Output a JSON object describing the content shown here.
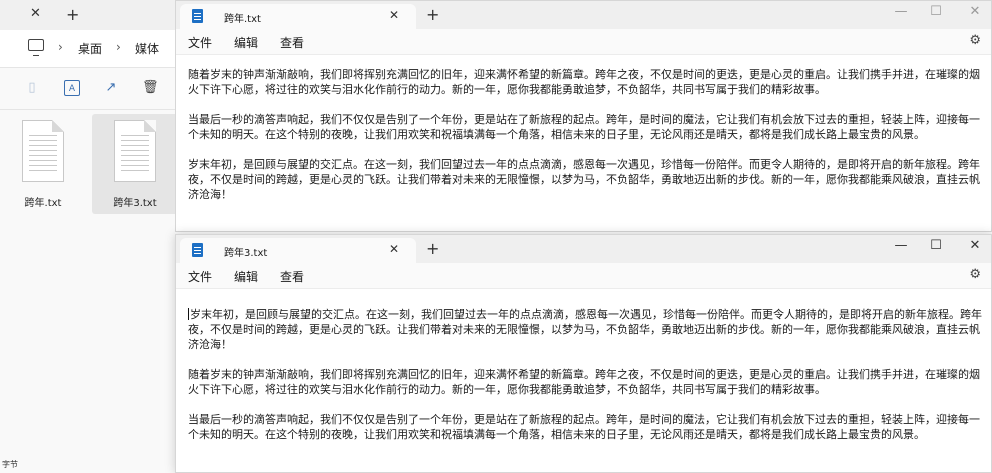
{
  "explorer": {
    "tab_close": "✕",
    "tab_add": "+",
    "breadcrumb": [
      "桌面",
      "媒体"
    ],
    "files": [
      {
        "name": "跨年.txt",
        "selected": false
      },
      {
        "name": "跨年3.txt",
        "selected": true
      }
    ],
    "status_text": "字节"
  },
  "notepad_back": {
    "tab_title": "跨年.txt",
    "menu": [
      "文件",
      "编辑",
      "查看"
    ],
    "paragraphs": [
      "随着岁末的钟声渐渐敲响，我们即将挥别充满回忆的旧年，迎来满怀希望的新篇章。跨年之夜，不仅是时间的更迭，更是心灵的重启。让我们携手并进，在璀璨的烟火下许下心愿，将过往的欢笑与泪水化作前行的动力。新的一年，愿你我都能勇敢追梦，不负韶华，共同书写属于我们的精彩故事。",
      "当最后一秒的滴答声响起，我们不仅仅是告别了一个年份，更是站在了新旅程的起点。跨年，是时间的魔法，它让我们有机会放下过去的重担，轻装上阵，迎接每一个未知的明天。在这个特别的夜晚，让我们用欢笑和祝福填满每一个角落，相信未来的日子里，无论风雨还是晴天，都将是我们成长路上最宝贵的风景。",
      "岁末年初，是回顾与展望的交汇点。在这一刻，我们回望过去一年的点点滴滴，感恩每一次遇见，珍惜每一份陪伴。而更令人期待的，是即将开启的新年旅程。跨年夜，不仅是时间的跨越，更是心灵的飞跃。让我们带着对未来的无限憧憬，以梦为马，不负韶华，勇敢地迈出新的步伐。新的一年，愿你我都能乘风破浪，直挂云帆济沧海！"
    ]
  },
  "notepad_front": {
    "tab_title": "跨年3.txt",
    "menu": [
      "文件",
      "编辑",
      "查看"
    ],
    "paragraphs": [
      "岁末年初，是回顾与展望的交汇点。在这一刻，我们回望过去一年的点点滴滴，感恩每一次遇见，珍惜每一份陪伴。而更令人期待的，是即将开启的新年旅程。跨年夜，不仅是时间的跨越，更是心灵的飞跃。让我们带着对未来的无限憧憬，以梦为马，不负韶华，勇敢地迈出新的步伐。新的一年，愿你我都能乘风破浪，直挂云帆济沧海！",
      "随着岁末的钟声渐渐敲响，我们即将挥别充满回忆的旧年，迎来满怀希望的新篇章。跨年之夜，不仅是时间的更迭，更是心灵的重启。让我们携手并进，在璀璨的烟火下许下心愿，将过往的欢笑与泪水化作前行的动力。新的一年，愿你我都能勇敢追梦，不负韶华，共同书写属于我们的精彩故事。",
      "当最后一秒的滴答声响起，我们不仅仅是告别了一个年份，更是站在了新旅程的起点。跨年，是时间的魔法，它让我们有机会放下过去的重担，轻装上阵，迎接每一个未知的明天。在这个特别的夜晚，让我们用欢笑和祝福填满每一个角落，相信未来的日子里，无论风雨还是晴天，都将是我们成长路上最宝贵的风景。"
    ]
  },
  "icons": {
    "close": "✕",
    "plus": "+",
    "minimize": "—",
    "maximize": "☐",
    "gear": "⚙",
    "chevron": "›"
  },
  "colors": {
    "accent": "#1d6fc4",
    "selection": "#e5e5e5"
  }
}
